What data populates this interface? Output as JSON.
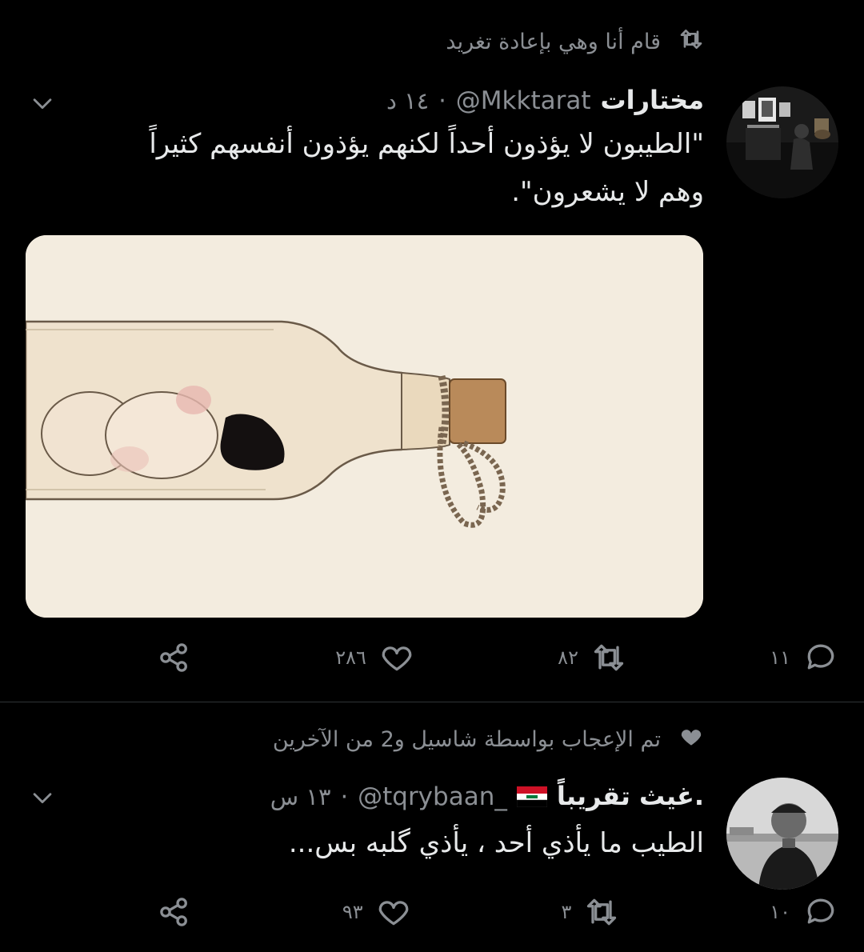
{
  "tweet1": {
    "context": "قام أنا وهي بإعادة تغريد",
    "author_name": "مختارات",
    "handle": "@Mkktarat",
    "dot": "·",
    "time": "١٤ د",
    "text_line1": "\"الطيبون لا يؤذون أحداً لكنهم يؤذون أنفسهم كثيراً",
    "text_line2": "وهم لا يشعرون\".",
    "replies": "١١",
    "retweets": "٨٢",
    "likes": "٢٨٦"
  },
  "tweet2": {
    "context": "تم الإعجاب بواسطة شاسيل و2 من الآخرين",
    "author_name": "غيث تقريباً.",
    "flag": "🇮🇶",
    "handle": "@tqrybaan_",
    "dot": "·",
    "time": "١٣ س",
    "text": "الطيب ما يأذي أحد ، يأذي گلبه بس...",
    "replies": "١٠",
    "retweets": "٣",
    "likes": "٩٣"
  },
  "colors": {
    "background": "#000000",
    "primary_text": "#e7e9ea",
    "secondary_text": "#8b8f94",
    "divider": "#2f3336"
  }
}
